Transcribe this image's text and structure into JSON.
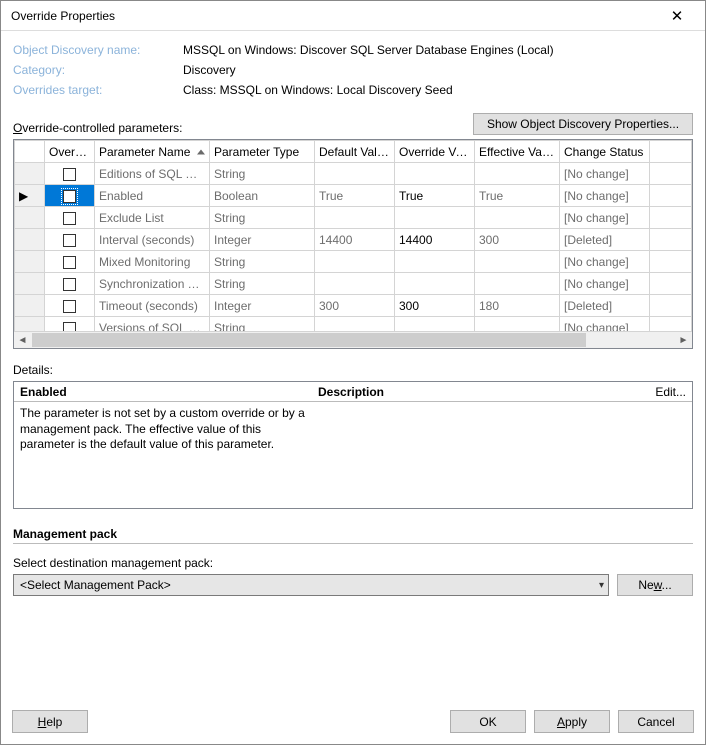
{
  "window": {
    "title": "Override Properties"
  },
  "header": {
    "labels": {
      "discovery_name": "Object Discovery name:",
      "category": "Category:",
      "overrides_target": "Overrides target:"
    },
    "values": {
      "discovery_name": "MSSQL on Windows: Discover SQL Server Database Engines (Local)",
      "category": "Discovery",
      "overrides_target": "Class: MSSQL on Windows: Local Discovery Seed"
    }
  },
  "section": {
    "override_params_label_pre": "O",
    "override_params_label_rest": "verride-controlled parameters:",
    "show_props_button": "Show Object Discovery Properties..."
  },
  "grid": {
    "columns": [
      "Override",
      "Parameter Name",
      "Parameter Type",
      "Default Value",
      "Override Value",
      "Effective Value",
      "Change Status"
    ],
    "rows": [
      {
        "marker": "",
        "checked": false,
        "selected": false,
        "name": "Editions of SQL Ser...",
        "type": "String",
        "def": "",
        "ov": "",
        "eff": "",
        "status": "[No change]"
      },
      {
        "marker": "▶",
        "checked": false,
        "selected": true,
        "name": "Enabled",
        "type": "Boolean",
        "def": "True",
        "ov": "True",
        "eff": "True",
        "status": "[No change]"
      },
      {
        "marker": "",
        "checked": false,
        "selected": false,
        "name": "Exclude List",
        "type": "String",
        "def": "",
        "ov": "",
        "eff": "",
        "status": "[No change]"
      },
      {
        "marker": "",
        "checked": false,
        "selected": false,
        "name": "Interval (seconds)",
        "type": "Integer",
        "def": "14400",
        "ov": "14400",
        "eff": "300",
        "status": "[Deleted]"
      },
      {
        "marker": "",
        "checked": false,
        "selected": false,
        "name": "Mixed Monitoring",
        "type": "String",
        "def": "",
        "ov": "",
        "eff": "",
        "status": "[No change]"
      },
      {
        "marker": "",
        "checked": false,
        "selected": false,
        "name": "Synchronization Time",
        "type": "String",
        "def": "",
        "ov": "",
        "eff": "",
        "status": "[No change]"
      },
      {
        "marker": "",
        "checked": false,
        "selected": false,
        "name": "Timeout (seconds)",
        "type": "Integer",
        "def": "300",
        "ov": "300",
        "eff": "180",
        "status": "[Deleted]"
      },
      {
        "marker": "",
        "checked": false,
        "selected": false,
        "name": "Versions of SQL Se...",
        "type": "String",
        "def": "",
        "ov": "",
        "eff": "",
        "status": "[No change]"
      }
    ]
  },
  "details": {
    "section_label": "Details:",
    "col1_header": "Enabled",
    "col2_header": "Description",
    "edit_label": "Edit...",
    "body": "The parameter is not set by a custom override or by a management pack. The effective value of this parameter is the default value of this parameter."
  },
  "mp": {
    "header": "Management pack",
    "sub": "Select destination management pack:",
    "selected": "<Select Management Pack>",
    "new_pre": "Ne",
    "new_ul": "w",
    "new_post": "..."
  },
  "footer": {
    "help_ul": "H",
    "help_rest": "elp",
    "ok": "OK",
    "apply_ul": "A",
    "apply_rest": "pply",
    "cancel": "Cancel"
  }
}
